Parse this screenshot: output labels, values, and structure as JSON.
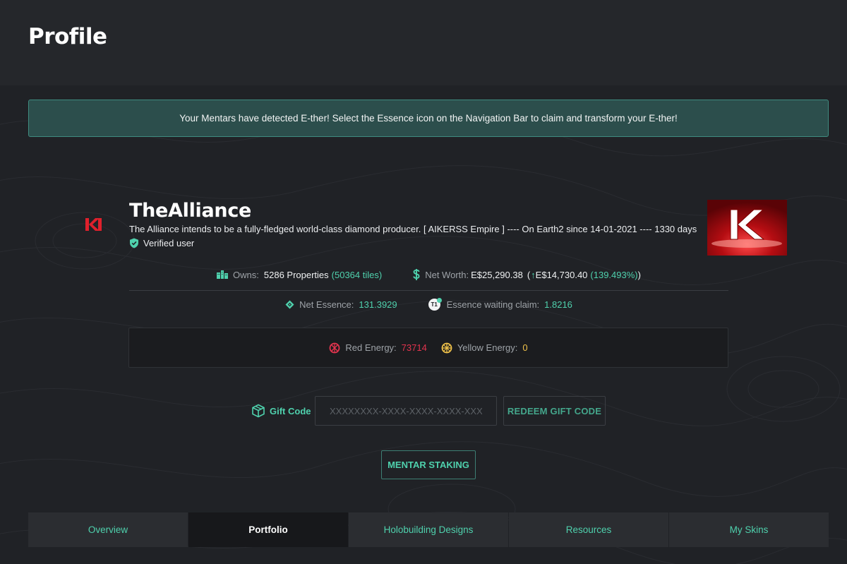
{
  "page": {
    "title": "Profile"
  },
  "alert": {
    "text": "Your Mentars have detected E-ther! Select the Essence icon on the Navigation Bar to claim and transform your E-ther!"
  },
  "profile": {
    "username": "TheAlliance",
    "bio": "The Alliance intends to be a fully-fledged world-class diamond producer. [ AIKERSS Empire ] ---- On Earth2 since 14-01-2021 ---- 1330 days",
    "verified_label": "Verified user"
  },
  "stats": {
    "owns_label": "Owns:",
    "owns_value": "5286 Properties",
    "owns_tiles": "(50364 tiles)",
    "networth_label": "Net Worth:",
    "networth_value": "E$25,290.38",
    "networth_open": "(",
    "networth_change": "E$14,730.40",
    "networth_percent": "(139.493%)",
    "networth_close": ")",
    "essence_label": "Net Essence:",
    "essence_value": "131.3929",
    "waiting_label": "Essence waiting claim:",
    "waiting_value": "1.8216",
    "t1_badge": "T1"
  },
  "energy": {
    "red_label": "Red Energy:",
    "red_value": "73714",
    "yellow_label": "Yellow Energy:",
    "yellow_value": "0"
  },
  "gift": {
    "label": "Gift Code",
    "placeholder": "XXXXXXXX-XXXX-XXXX-XXXX-XXX",
    "redeem_label": "REDEEM GIFT CODE"
  },
  "staking": {
    "label": "MENTAR STAKING"
  },
  "tabs": [
    {
      "label": "Overview"
    },
    {
      "label": "Portfolio"
    },
    {
      "label": "Holobuilding Designs"
    },
    {
      "label": "Resources"
    },
    {
      "label": "My Skins"
    }
  ],
  "colors": {
    "accent": "#4fd1ad",
    "red_energy": "#e3344e",
    "yellow_energy": "#f0c24a",
    "alert_bg": "#2c4e4c"
  },
  "icons": {
    "verified": "shield-check-icon",
    "owns": "buildings-icon",
    "networth": "dollar-icon",
    "essence": "essence-diamond-icon",
    "waiting": "t1-badge-icon",
    "red_energy": "red-energy-icon",
    "yellow_energy": "yellow-energy-icon",
    "gift": "gift-cube-icon"
  }
}
